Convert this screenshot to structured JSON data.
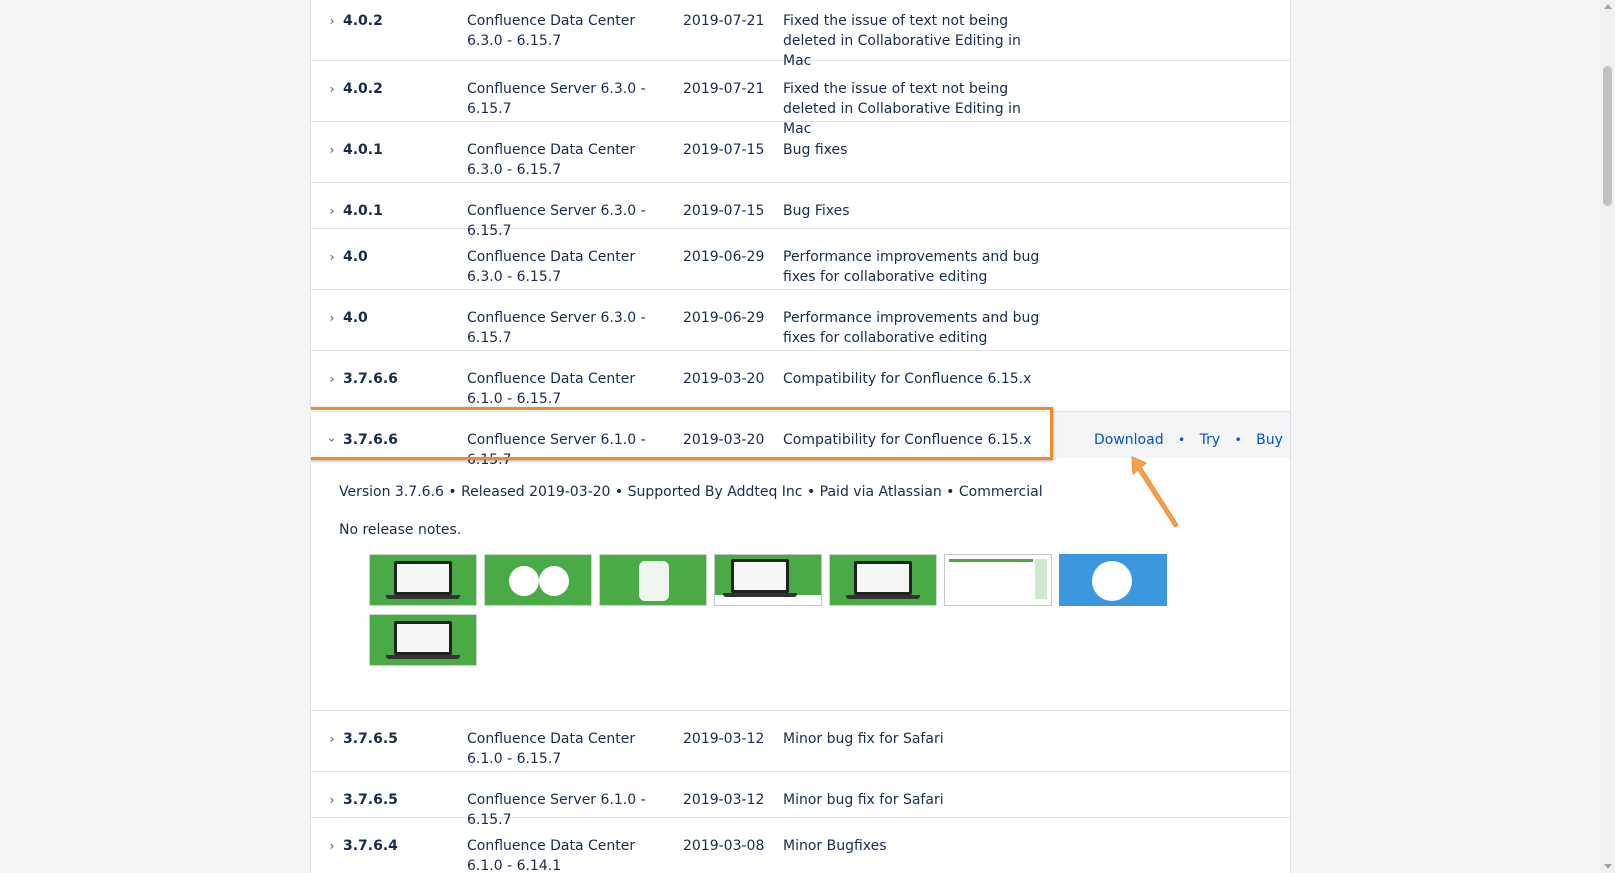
{
  "rows_before": [
    {
      "version": "4.0.2",
      "compat": "Confluence Data Center 6.3.0 - 6.15.7",
      "date": "2019-07-21",
      "notes": "Fixed the issue of text not being deleted in Collaborative Editing in Mac"
    },
    {
      "version": "4.0.2",
      "compat": "Confluence Server 6.3.0 - 6.15.7",
      "date": "2019-07-21",
      "notes": "Fixed the issue of text not being deleted in Collaborative Editing in Mac"
    },
    {
      "version": "4.0.1",
      "compat": "Confluence Data Center 6.3.0 - 6.15.7",
      "date": "2019-07-15",
      "notes": "Bug fixes"
    },
    {
      "version": "4.0.1",
      "compat": "Confluence Server 6.3.0 - 6.15.7",
      "date": "2019-07-15",
      "notes": "Bug Fixes"
    },
    {
      "version": "4.0",
      "compat": "Confluence Data Center 6.3.0 - 6.15.7",
      "date": "2019-06-29",
      "notes": "Performance improvements and bug fixes for collaborative editing"
    },
    {
      "version": "4.0",
      "compat": "Confluence Server 6.3.0 - 6.15.7",
      "date": "2019-06-29",
      "notes": "Performance improvements and bug fixes for collaborative editing"
    },
    {
      "version": "3.7.6.6",
      "compat": "Confluence Data Center 6.1.0 - 6.15.7",
      "date": "2019-03-20",
      "notes": "Compatibility for Confluence 6.15.x"
    }
  ],
  "expanded": {
    "version": "3.7.6.6",
    "compat": "Confluence Server 6.1.0 - 6.15.7",
    "date": "2019-03-20",
    "notes": "Compatibility for Confluence 6.15.x",
    "actions": {
      "download": "Download",
      "sep": "•",
      "try": "Try",
      "buy": "Buy"
    },
    "meta": "Version 3.7.6.6 • Released 2019-03-20 • Supported By Addteq Inc • Paid via Atlassian • Commercial",
    "release_notes": "No release notes.",
    "screenshot_count": 8
  },
  "rows_after": [
    {
      "version": "3.7.6.5",
      "compat": "Confluence Data Center 6.1.0 - 6.15.7",
      "date": "2019-03-12",
      "notes": "Minor bug fix for Safari"
    },
    {
      "version": "3.7.6.5",
      "compat": "Confluence Server 6.1.0 - 6.15.7",
      "date": "2019-03-12",
      "notes": "Minor bug fix for Safari"
    },
    {
      "version": "3.7.6.4",
      "compat": "Confluence Data Center 6.1.0 - 6.14.1",
      "date": "2019-03-08",
      "notes": "Minor Bugfixes"
    }
  ],
  "icons": {
    "collapsed": "chevron-right-icon",
    "expanded": "chevron-down-icon"
  },
  "colors": {
    "link": "#0052cc",
    "highlight": "#f08c28",
    "thumb_green": "#4aaa45",
    "thumb_blue": "#3b97e0"
  }
}
